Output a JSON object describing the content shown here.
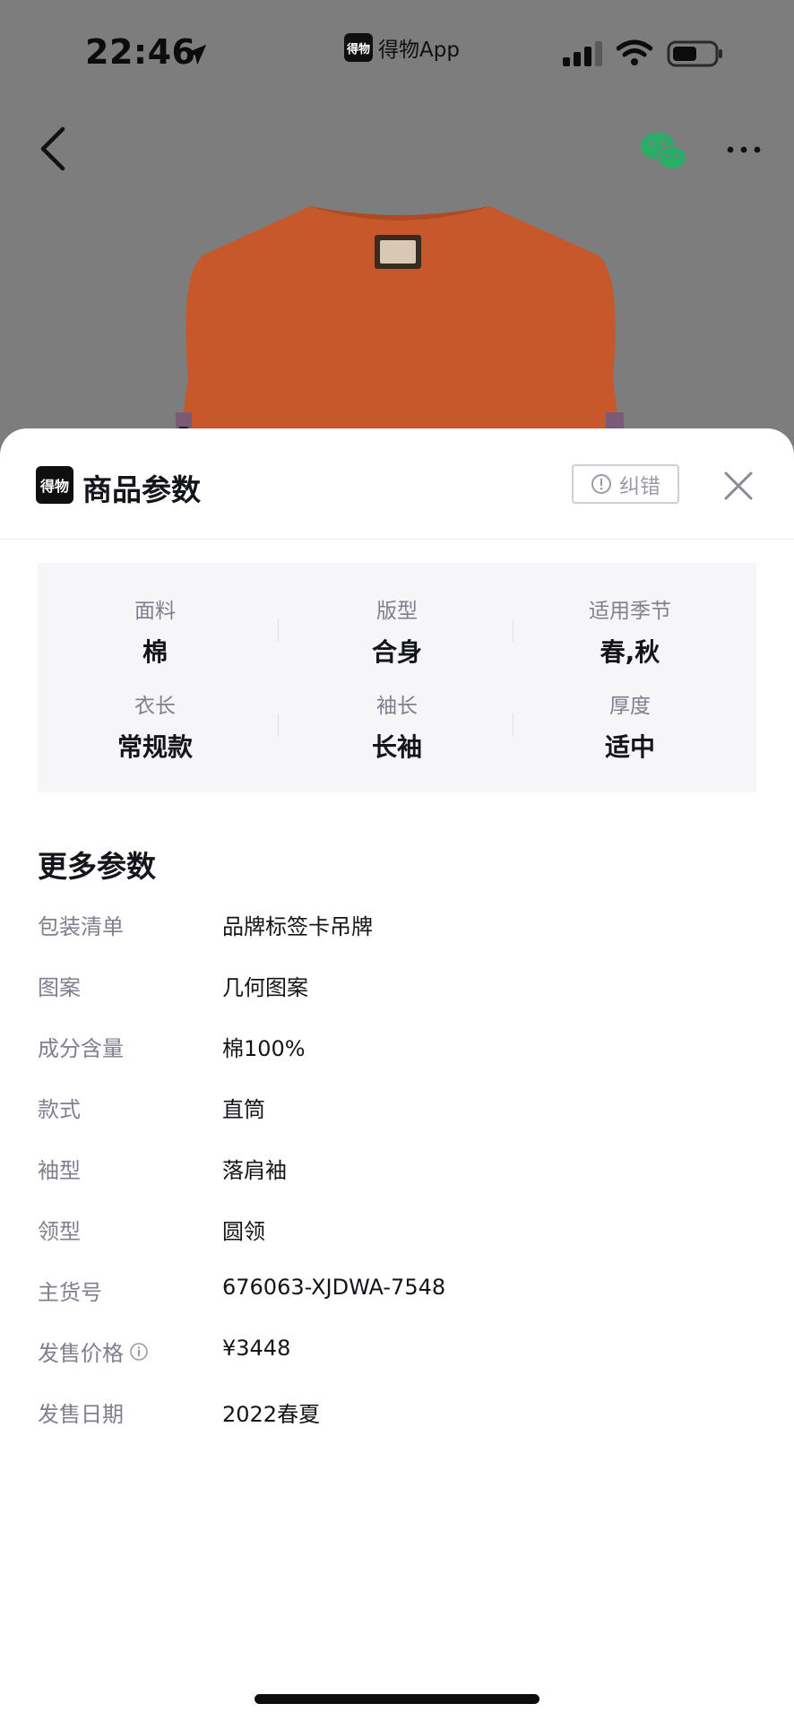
{
  "status_bar": {
    "time": "22:46",
    "app_name": "得物App",
    "app_badge": "得物"
  },
  "icons": {
    "location": "location-arrow-icon",
    "signal": "signal-icon",
    "wifi": "wifi-icon",
    "battery": "battery-icon",
    "back": "chevron-left-icon",
    "wechat": "wechat-icon",
    "more": "more-dots-icon",
    "close": "close-icon",
    "alert": "alert-circle-icon",
    "info": "info-icon"
  },
  "sheet": {
    "logo": "得物",
    "title": "商品参数",
    "correct_label": "纠错",
    "summary": [
      {
        "label": "面料",
        "value": "棉"
      },
      {
        "label": "版型",
        "value": "合身"
      },
      {
        "label": "适用季节",
        "value": "春,秋"
      },
      {
        "label": "衣长",
        "value": "常规款"
      },
      {
        "label": "袖长",
        "value": "长袖"
      },
      {
        "label": "厚度",
        "value": "适中"
      }
    ],
    "more_title": "更多参数",
    "params": [
      {
        "key": "包装清单",
        "value": "品牌标签卡吊牌"
      },
      {
        "key": "图案",
        "value": "几何图案"
      },
      {
        "key": "成分含量",
        "value": "棉100%"
      },
      {
        "key": "款式",
        "value": "直筒"
      },
      {
        "key": "袖型",
        "value": "落肩袖"
      },
      {
        "key": "领型",
        "value": "圆领"
      },
      {
        "key": "主货号",
        "value": "676063-XJDWA-7548"
      },
      {
        "key": "发售价格",
        "value": "¥3448"
      },
      {
        "key": "发售日期",
        "value": "2022春夏"
      }
    ]
  },
  "colors": {
    "overlay": "#7d7d7d",
    "product": "#e0592a",
    "wechat_green": "#2aae67",
    "text_primary": "#14151a",
    "text_secondary": "#7f7f8e"
  }
}
